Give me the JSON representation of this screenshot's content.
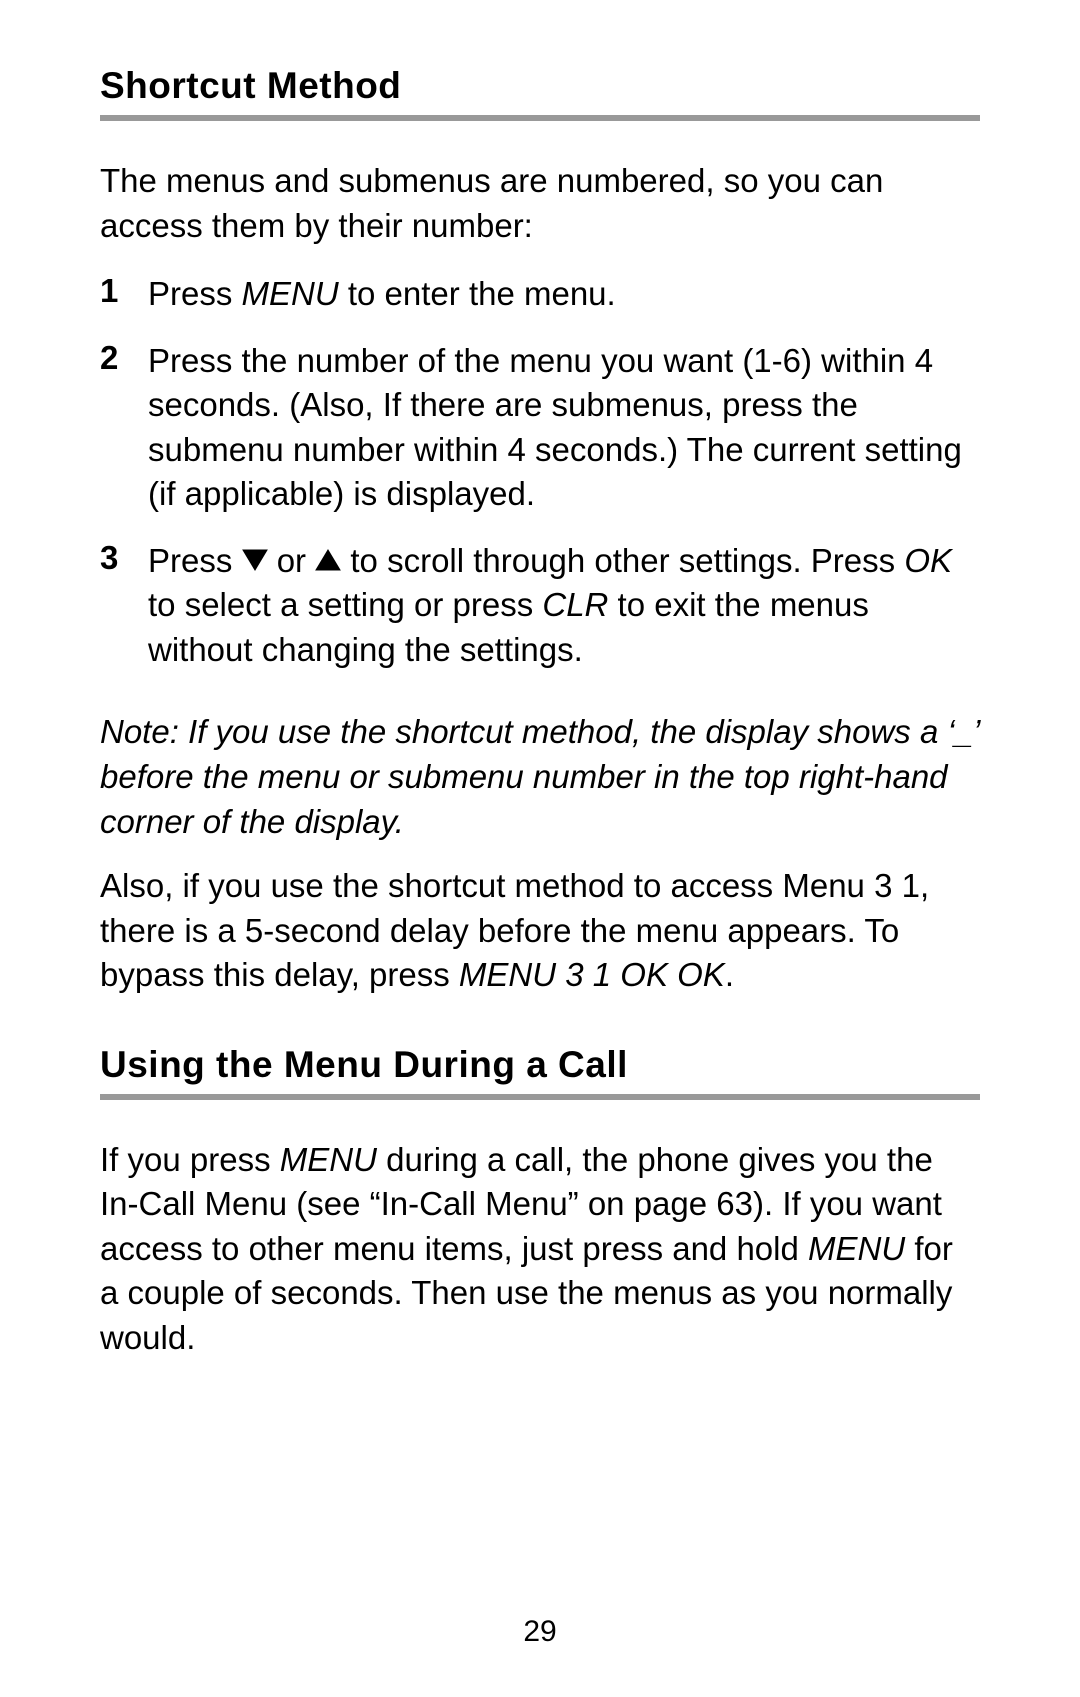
{
  "section1": {
    "heading": "Shortcut Method",
    "intro": "The menus and submenus are numbered, so you can access them by their number:",
    "steps": [
      {
        "num": "1",
        "pre": "Press ",
        "key1": "MENU",
        "post": " to enter the menu."
      },
      {
        "num": "2",
        "text": "Press the number of the menu you want (1-6) within 4 seconds. (Also, If there are submenus, press the submenu number within 4 seconds.) The current setting (if applicable) is displayed."
      },
      {
        "num": "3",
        "pre": "Press ",
        "mid1": " or ",
        "mid2": " to scroll through other settings. Press ",
        "key1": "OK",
        "mid3": " to select a setting or press ",
        "key2": "CLR",
        "post": " to exit the menus without changing the settings."
      }
    ],
    "note": "Note: If you use the shortcut method, the display shows a ‘_’ before the menu or submenu number in the top right-hand corner of the display.",
    "also_pre": "Also, if you use the shortcut method to access Menu 3 1, there is a 5-second delay before the menu appears. To bypass this delay, press ",
    "also_key": "MENU 3 1 OK OK",
    "also_post": "."
  },
  "section2": {
    "heading": "Using the Menu During a Call",
    "body_pre": "If you press ",
    "key1": "MENU",
    "body_mid1": " during a call, the phone gives you the In-Call Menu (see “In-Call Menu” on page 63). If you want access to other menu items, just press and hold ",
    "key2": "MENU",
    "body_post": " for a couple of seconds. Then use the menus as you normally would."
  },
  "page_number": "29"
}
